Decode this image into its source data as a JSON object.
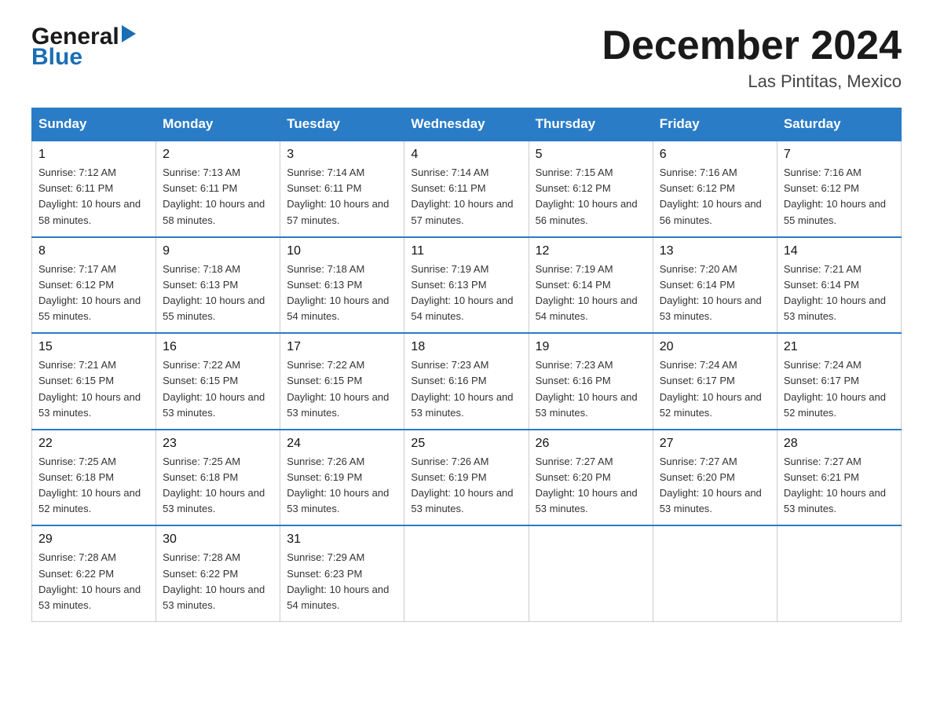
{
  "logo": {
    "general": "General",
    "blue": "Blue",
    "triangle": "▶"
  },
  "header": {
    "month_year": "December 2024",
    "location": "Las Pintitas, Mexico"
  },
  "weekdays": [
    "Sunday",
    "Monday",
    "Tuesday",
    "Wednesday",
    "Thursday",
    "Friday",
    "Saturday"
  ],
  "weeks": [
    [
      {
        "day": "1",
        "sunrise": "7:12 AM",
        "sunset": "6:11 PM",
        "daylight": "10 hours and 58 minutes."
      },
      {
        "day": "2",
        "sunrise": "7:13 AM",
        "sunset": "6:11 PM",
        "daylight": "10 hours and 58 minutes."
      },
      {
        "day": "3",
        "sunrise": "7:14 AM",
        "sunset": "6:11 PM",
        "daylight": "10 hours and 57 minutes."
      },
      {
        "day": "4",
        "sunrise": "7:14 AM",
        "sunset": "6:11 PM",
        "daylight": "10 hours and 57 minutes."
      },
      {
        "day": "5",
        "sunrise": "7:15 AM",
        "sunset": "6:12 PM",
        "daylight": "10 hours and 56 minutes."
      },
      {
        "day": "6",
        "sunrise": "7:16 AM",
        "sunset": "6:12 PM",
        "daylight": "10 hours and 56 minutes."
      },
      {
        "day": "7",
        "sunrise": "7:16 AM",
        "sunset": "6:12 PM",
        "daylight": "10 hours and 55 minutes."
      }
    ],
    [
      {
        "day": "8",
        "sunrise": "7:17 AM",
        "sunset": "6:12 PM",
        "daylight": "10 hours and 55 minutes."
      },
      {
        "day": "9",
        "sunrise": "7:18 AM",
        "sunset": "6:13 PM",
        "daylight": "10 hours and 55 minutes."
      },
      {
        "day": "10",
        "sunrise": "7:18 AM",
        "sunset": "6:13 PM",
        "daylight": "10 hours and 54 minutes."
      },
      {
        "day": "11",
        "sunrise": "7:19 AM",
        "sunset": "6:13 PM",
        "daylight": "10 hours and 54 minutes."
      },
      {
        "day": "12",
        "sunrise": "7:19 AM",
        "sunset": "6:14 PM",
        "daylight": "10 hours and 54 minutes."
      },
      {
        "day": "13",
        "sunrise": "7:20 AM",
        "sunset": "6:14 PM",
        "daylight": "10 hours and 53 minutes."
      },
      {
        "day": "14",
        "sunrise": "7:21 AM",
        "sunset": "6:14 PM",
        "daylight": "10 hours and 53 minutes."
      }
    ],
    [
      {
        "day": "15",
        "sunrise": "7:21 AM",
        "sunset": "6:15 PM",
        "daylight": "10 hours and 53 minutes."
      },
      {
        "day": "16",
        "sunrise": "7:22 AM",
        "sunset": "6:15 PM",
        "daylight": "10 hours and 53 minutes."
      },
      {
        "day": "17",
        "sunrise": "7:22 AM",
        "sunset": "6:15 PM",
        "daylight": "10 hours and 53 minutes."
      },
      {
        "day": "18",
        "sunrise": "7:23 AM",
        "sunset": "6:16 PM",
        "daylight": "10 hours and 53 minutes."
      },
      {
        "day": "19",
        "sunrise": "7:23 AM",
        "sunset": "6:16 PM",
        "daylight": "10 hours and 53 minutes."
      },
      {
        "day": "20",
        "sunrise": "7:24 AM",
        "sunset": "6:17 PM",
        "daylight": "10 hours and 52 minutes."
      },
      {
        "day": "21",
        "sunrise": "7:24 AM",
        "sunset": "6:17 PM",
        "daylight": "10 hours and 52 minutes."
      }
    ],
    [
      {
        "day": "22",
        "sunrise": "7:25 AM",
        "sunset": "6:18 PM",
        "daylight": "10 hours and 52 minutes."
      },
      {
        "day": "23",
        "sunrise": "7:25 AM",
        "sunset": "6:18 PM",
        "daylight": "10 hours and 53 minutes."
      },
      {
        "day": "24",
        "sunrise": "7:26 AM",
        "sunset": "6:19 PM",
        "daylight": "10 hours and 53 minutes."
      },
      {
        "day": "25",
        "sunrise": "7:26 AM",
        "sunset": "6:19 PM",
        "daylight": "10 hours and 53 minutes."
      },
      {
        "day": "26",
        "sunrise": "7:27 AM",
        "sunset": "6:20 PM",
        "daylight": "10 hours and 53 minutes."
      },
      {
        "day": "27",
        "sunrise": "7:27 AM",
        "sunset": "6:20 PM",
        "daylight": "10 hours and 53 minutes."
      },
      {
        "day": "28",
        "sunrise": "7:27 AM",
        "sunset": "6:21 PM",
        "daylight": "10 hours and 53 minutes."
      }
    ],
    [
      {
        "day": "29",
        "sunrise": "7:28 AM",
        "sunset": "6:22 PM",
        "daylight": "10 hours and 53 minutes."
      },
      {
        "day": "30",
        "sunrise": "7:28 AM",
        "sunset": "6:22 PM",
        "daylight": "10 hours and 53 minutes."
      },
      {
        "day": "31",
        "sunrise": "7:29 AM",
        "sunset": "6:23 PM",
        "daylight": "10 hours and 54 minutes."
      },
      null,
      null,
      null,
      null
    ]
  ]
}
